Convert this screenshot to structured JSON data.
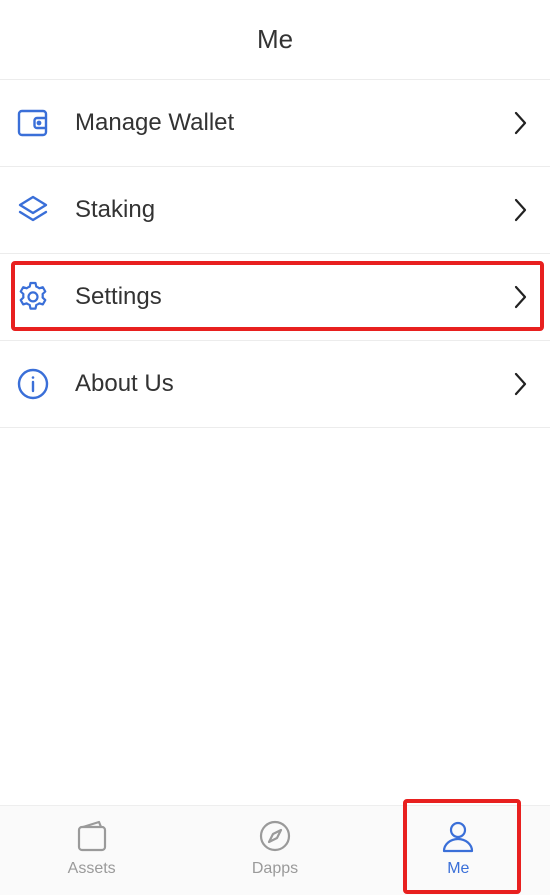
{
  "header": {
    "title": "Me"
  },
  "menu": {
    "items": [
      {
        "label": "Manage Wallet",
        "icon": "wallet-icon"
      },
      {
        "label": "Staking",
        "icon": "layers-icon"
      },
      {
        "label": "Settings",
        "icon": "gear-icon"
      },
      {
        "label": "About Us",
        "icon": "info-icon"
      }
    ]
  },
  "tabbar": {
    "tabs": [
      {
        "label": "Assets",
        "icon": "wallet-tab-icon",
        "active": false
      },
      {
        "label": "Dapps",
        "icon": "compass-icon",
        "active": false
      },
      {
        "label": "Me",
        "icon": "user-icon",
        "active": true
      }
    ]
  },
  "colors": {
    "accent": "#3a6fd8",
    "icon_blue": "#3a6fd8",
    "inactive": "#9a9a9a",
    "highlight_box": "#e8201f",
    "divider": "#ececec"
  }
}
